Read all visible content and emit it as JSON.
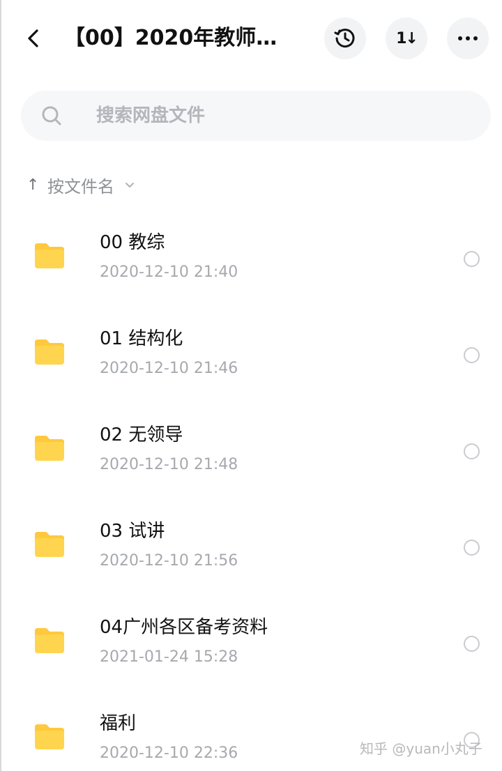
{
  "header": {
    "title": "【00】2020年教师…",
    "back_icon": "back-arrow-icon",
    "history_icon": "history-icon",
    "sort_icon": "sort-order-icon",
    "sort_glyph": "1↓",
    "more_icon": "more-icon"
  },
  "search": {
    "placeholder": "搜索网盘文件"
  },
  "sort": {
    "arrow": "↑",
    "label": "按文件名"
  },
  "files": [
    {
      "name": "00 教综",
      "time": "2020-12-10  21:40",
      "icon": "folder-icon"
    },
    {
      "name": "01 结构化",
      "time": "2020-12-10  21:46",
      "icon": "folder-icon"
    },
    {
      "name": "02 无领导",
      "time": "2020-12-10  21:48",
      "icon": "folder-icon"
    },
    {
      "name": "03 试讲",
      "time": "2020-12-10  21:56",
      "icon": "folder-icon"
    },
    {
      "name": "04广州各区备考资料",
      "time": "2021-01-24  15:28",
      "icon": "folder-icon"
    },
    {
      "name": "福利",
      "time": "2020-12-10  22:36",
      "icon": "folder-icon"
    }
  ],
  "watermark": "知乎 @yuan小丸子",
  "colors": {
    "folder": "#FFD54F",
    "folder_tab": "#FFC83D",
    "button_bg": "#F2F3F5",
    "search_bg": "#F6F7F9",
    "secondary_text": "#A6A9AD"
  }
}
